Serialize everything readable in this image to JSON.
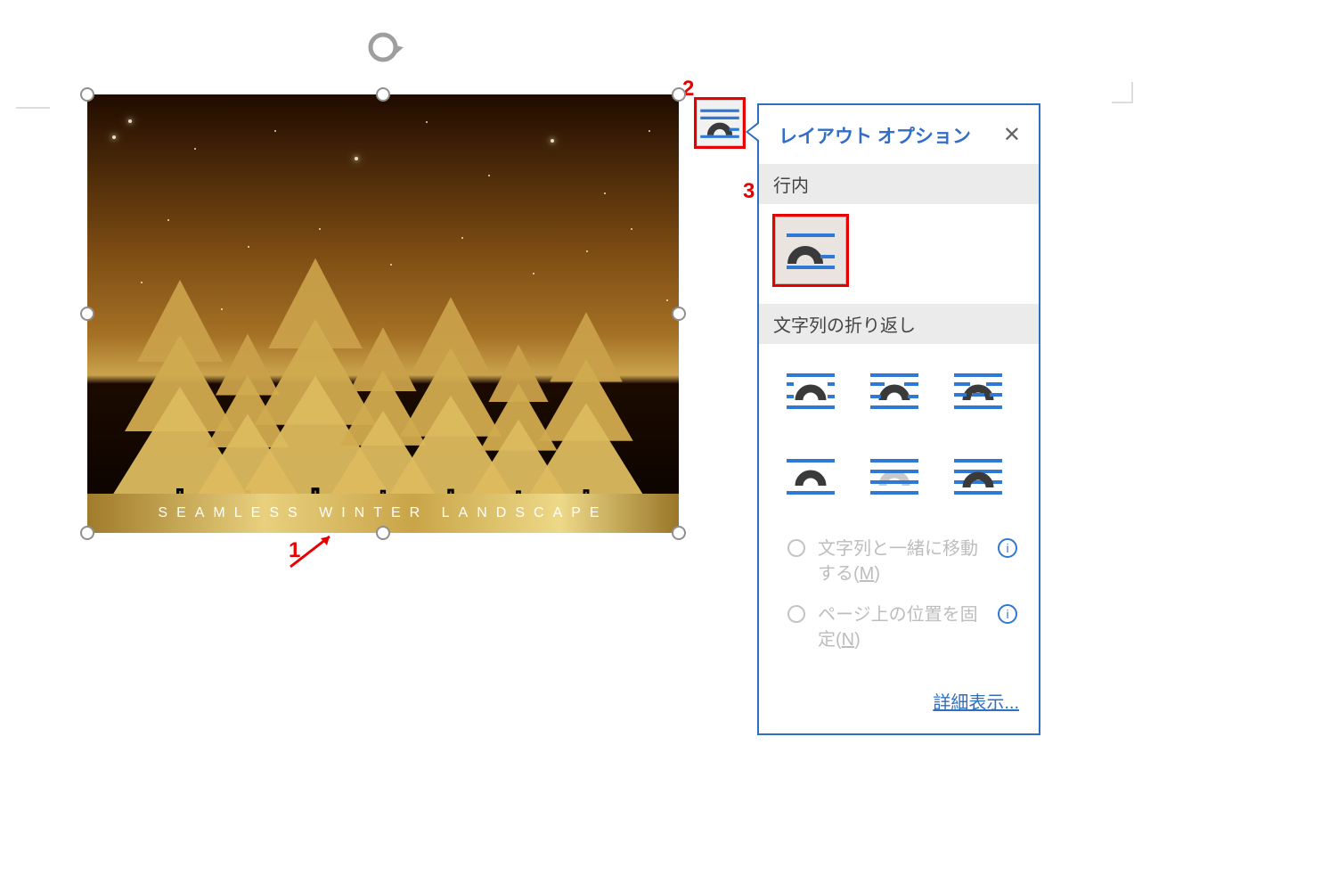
{
  "image": {
    "banner_text": "SEAMLESS WINTER LANDSCAPE"
  },
  "callouts": {
    "n1": "1",
    "n2": "2",
    "n3": "3"
  },
  "popover": {
    "title": "レイアウト オプション",
    "close": "✕",
    "section_inline": "行内",
    "section_wrap": "文字列の折り返し",
    "radio_move": "文字列と一緒に移動する(",
    "radio_move_key": "M",
    "radio_move_tail": ")",
    "radio_fix": "ページ上の位置を固定(",
    "radio_fix_key": "N",
    "radio_fix_tail": ")",
    "see_more": "詳細表示..."
  },
  "icons": {
    "inline_label": "行内",
    "square": "四角",
    "tight": "外周",
    "through": "内部",
    "topbottom": "上下",
    "behind": "背面",
    "front": "前面"
  }
}
